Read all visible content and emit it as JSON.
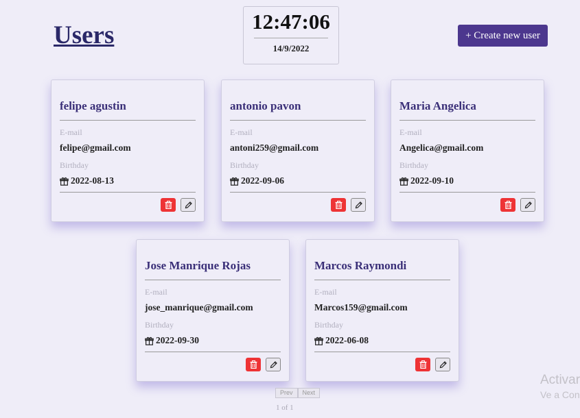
{
  "header": {
    "title": "Users",
    "create_button_label": "+ Create new user"
  },
  "clock": {
    "time": "12:47:06",
    "date": "14/9/2022"
  },
  "labels": {
    "email": "E-mail",
    "birthday": "Birthday"
  },
  "users": [
    {
      "name": "felipe agustin",
      "email": "felipe@gmail.com",
      "birthday": "2022-08-13"
    },
    {
      "name": "antonio pavon",
      "email": "antoni259@gmail.com",
      "birthday": "2022-09-06"
    },
    {
      "name": "Maria Angelica",
      "email": "Angelica@gmail.com",
      "birthday": "2022-09-10"
    },
    {
      "name": "Jose Manrique Rojas",
      "email": "jose_manrique@gmail.com",
      "birthday": "2022-09-30"
    },
    {
      "name": "Marcos Raymondi",
      "email": "Marcos159@gmail.com",
      "birthday": "2022-06-08"
    }
  ],
  "pagination": {
    "prev_label": "Prev",
    "next_label": "Next",
    "page_indicator": "1 of 1"
  },
  "watermark": {
    "line1": "Activar",
    "line2": "Ve a Con"
  },
  "icons": {
    "delete": "trash-icon",
    "edit": "pencil-icon",
    "birthday": "gift-icon"
  },
  "colors": {
    "background": "#efedf8",
    "accent": "#4c378e",
    "title": "#2a2868",
    "card_name": "#3a2f78",
    "delete": "#ee3335"
  }
}
